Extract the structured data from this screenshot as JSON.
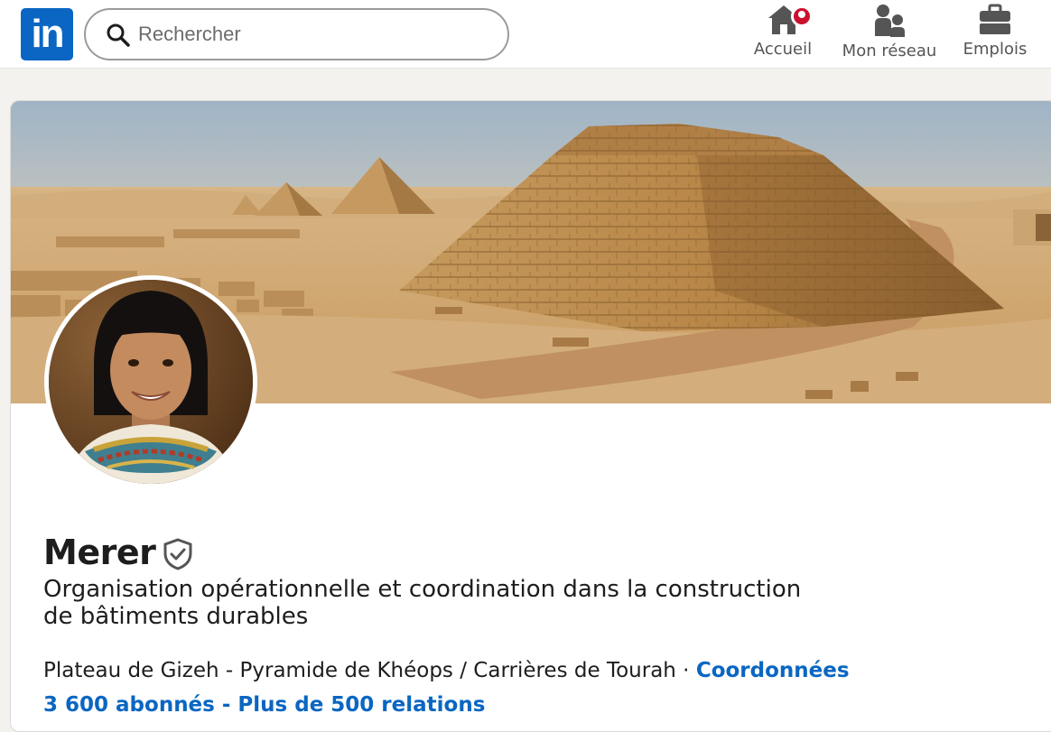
{
  "nav": {
    "logo_text": "in",
    "search_placeholder": "Rechercher",
    "items": [
      {
        "label": "Accueil",
        "icon": "home-icon"
      },
      {
        "label": "Mon réseau",
        "icon": "people-icon"
      },
      {
        "label": "Emplois",
        "icon": "briefcase-icon"
      }
    ],
    "notification_color": "#cb112d"
  },
  "profile": {
    "name": "Merer",
    "headline": "Organisation opérationnelle et coordination dans la construction de bâtiments durables",
    "location": "Plateau de Gizeh - Pyramide de Khéops / Carrières de Tourah",
    "location_separator": " · ",
    "contact_link": "Coordonnées",
    "stats": "3 600 abonnés - Plus de 500 relations"
  },
  "colors": {
    "brand": "#0a66c2",
    "page_bg": "#f4f2ee"
  }
}
